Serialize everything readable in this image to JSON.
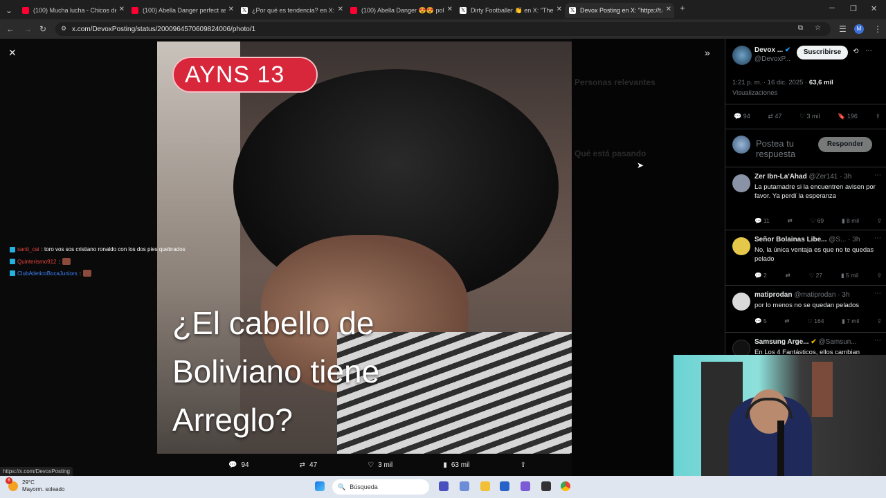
{
  "browser": {
    "tabs": [
      {
        "title": "(100) Mucha lucha - Chicos de",
        "color": "#ff0033",
        "active": false
      },
      {
        "title": "(100) Abella Danger perfect ass",
        "color": "#ff0033",
        "active": false
      },
      {
        "title": "¿Por qué es tendencia? en X: \"",
        "color": "#ffffff",
        "active": false
      },
      {
        "title": "(100) Abella Danger 😍😍 pol",
        "color": "#ff0033",
        "active": false
      },
      {
        "title": "Dirty Footballer 👏 en X: \"The",
        "color": "#ffffff",
        "active": false
      },
      {
        "title": "Devox Posting en X: \"https://t.c",
        "color": "#ffffff",
        "active": true
      }
    ],
    "url": "x.com/DevoxPosting/status/2000964570609824006/photo/1",
    "profile_initial": "M",
    "status_url": "https://x.com/DevoxPosting"
  },
  "photo": {
    "badge_text": "AYNS    13",
    "caption_lines": [
      "¿El cabello de",
      "Boliviano tiene",
      "Arreglo?"
    ],
    "actions": {
      "replies": "94",
      "reposts": "47",
      "likes": "3 mil",
      "views": "63 mil"
    }
  },
  "chat": [
    {
      "user": "santi_cai",
      "user_color": "#e0443c",
      "message": ": toro vos sos cristiano ronaldo con los dos pies quebrados"
    },
    {
      "user": "Quinterismo912",
      "user_color": "#e0443c",
      "message": ":"
    },
    {
      "user": "ClubAtleticoBocaJuniors",
      "user_color": "#3b82f6",
      "message": ":"
    }
  ],
  "rail_ghost": {
    "heading1": "Personas relevantes",
    "heading2": "Qué está pasando"
  },
  "post": {
    "author_name": "Devox ...",
    "author_handle": "@DevoxP...",
    "subscribe_label": "Suscribirse",
    "timestamp": "1:21 p. m. · 16 dic. 2025 ·",
    "views_count": "63,6 mil",
    "views_label": "Visualizaciones",
    "stats": {
      "replies": "94",
      "reposts": "47",
      "likes": "3 mil",
      "bookmarks": "196"
    },
    "reply_placeholder": "Postea tu respuesta",
    "reply_button": "Responder"
  },
  "replies": [
    {
      "name": "Zer Ibn-La'Ahad",
      "handle": "@Zer141 · 3h",
      "text": "La putamadre si la encuentren avisen por favor. Ya perdí la esperanza",
      "replies": "11",
      "likes": "69",
      "views": "8 mil",
      "avatar_color": "#8a93a6"
    },
    {
      "name": "Señor Bolainas Libe...",
      "handle": "@S... · 3h",
      "text": "No, la única ventaja es que no te quedas pelado",
      "replies": "2",
      "likes": "27",
      "views": "5 mil",
      "avatar_color": "#e5c84a"
    },
    {
      "name": "matiprodan",
      "handle": "@matiprodan · 3h",
      "text": "por lo menos no se quedan pelados",
      "replies": "5",
      "likes": "164",
      "views": "7 mil",
      "avatar_color": "#d9d9d9"
    },
    {
      "name": "Samsung Arge...",
      "handle": "@Samsun...",
      "text": "En Los 4 Fantásticos, ellos cambian",
      "avatar_color": "#111111"
    }
  ],
  "taskbar": {
    "weather_temp": "29°C",
    "weather_desc": "Mayorm. soleado",
    "weather_badge": "6",
    "search_label": "Búsqueda"
  }
}
